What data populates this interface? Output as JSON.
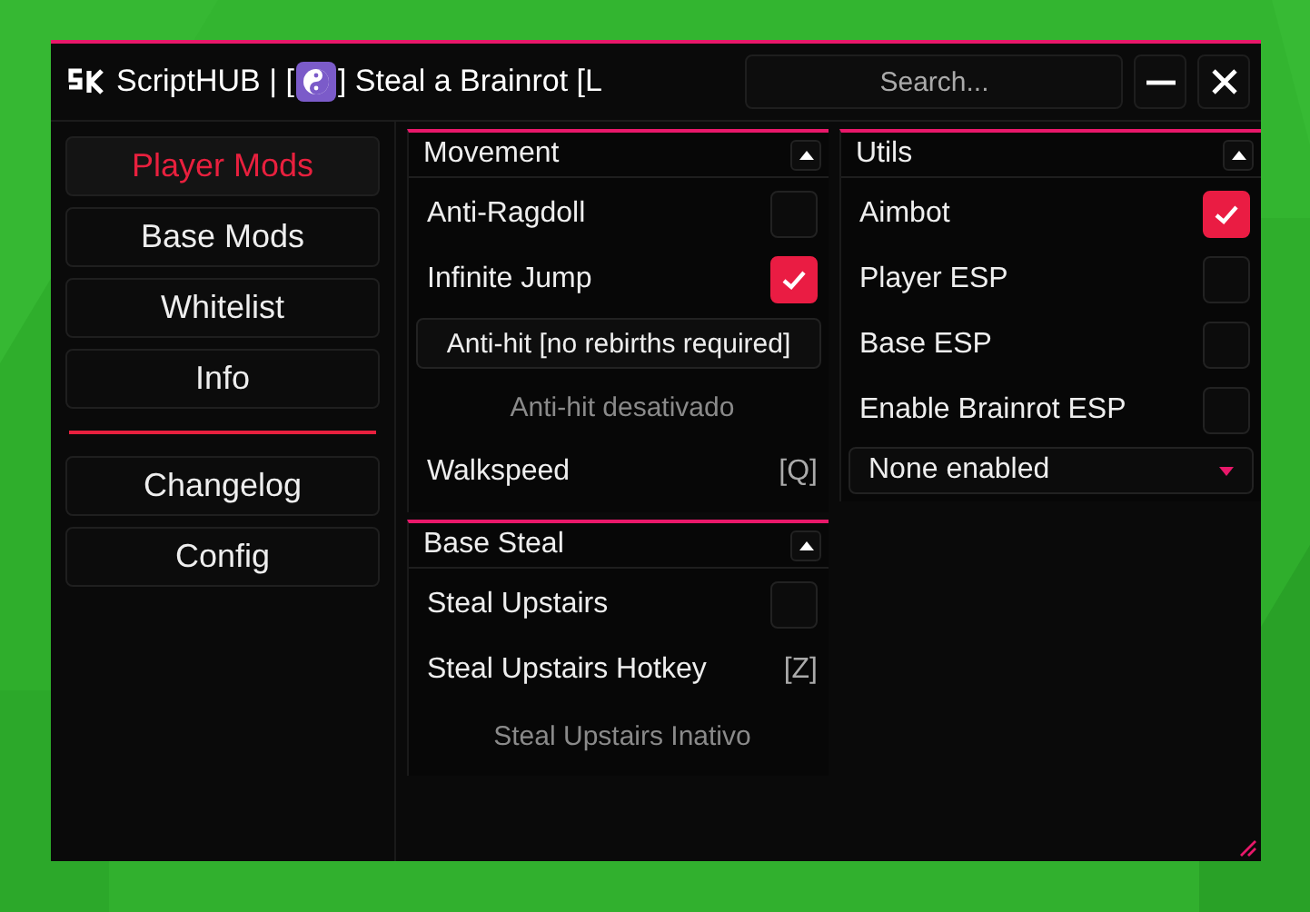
{
  "window": {
    "title_prefix": "ScriptHUB | [",
    "title_suffix": "] Steal a Brainrot [L"
  },
  "search": {
    "placeholder": "Search..."
  },
  "sidebar": {
    "items": [
      {
        "label": "Player Mods",
        "selected": true
      },
      {
        "label": "Base Mods",
        "selected": false
      },
      {
        "label": "Whitelist",
        "selected": false
      },
      {
        "label": "Info",
        "selected": false
      }
    ],
    "bottom_items": [
      {
        "label": "Changelog",
        "selected": false
      },
      {
        "label": "Config",
        "selected": false
      }
    ]
  },
  "columns": [
    {
      "sections": [
        {
          "title": "Movement",
          "expanded": true,
          "items": [
            {
              "kind": "toggle",
              "label": "Anti-Ragdoll",
              "checked": false
            },
            {
              "kind": "toggle",
              "label": "Infinite Jump",
              "checked": true
            },
            {
              "kind": "button",
              "label": "Anti-hit [no rebirths required]"
            },
            {
              "kind": "status",
              "label": "Anti-hit desativado"
            },
            {
              "kind": "keybind",
              "label": "Walkspeed",
              "key": "[Q]"
            }
          ]
        },
        {
          "title": "Base Steal",
          "expanded": true,
          "items": [
            {
              "kind": "toggle",
              "label": "Steal Upstairs",
              "checked": false
            },
            {
              "kind": "keybind",
              "label": "Steal Upstairs Hotkey",
              "key": "[Z]"
            },
            {
              "kind": "status",
              "label": "Steal Upstairs Inativo"
            }
          ]
        }
      ]
    },
    {
      "sections": [
        {
          "title": "Utils",
          "expanded": true,
          "items": [
            {
              "kind": "toggle",
              "label": "Aimbot",
              "checked": true
            },
            {
              "kind": "toggle",
              "label": "Player ESP",
              "checked": false
            },
            {
              "kind": "toggle",
              "label": "Base ESP",
              "checked": false
            },
            {
              "kind": "toggle",
              "label": "Enable Brainrot ESP",
              "checked": false
            },
            {
              "kind": "dropdown",
              "label": "None enabled"
            }
          ]
        }
      ]
    }
  ]
}
